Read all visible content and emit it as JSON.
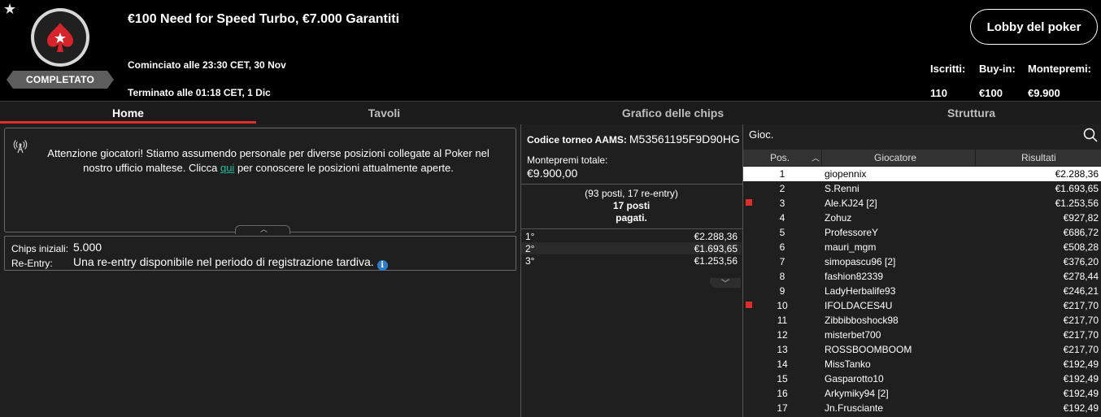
{
  "header": {
    "title": "€100 Need for Speed Turbo, €7.000 Garantiti",
    "status": "COMPLETATO",
    "started": "Cominciato alle 23:30 CET, 30 Nov",
    "ended": "Terminato alle 01:18 CET, 1 Dic",
    "lobby_button": "Lobby del poker",
    "stats": [
      {
        "label": "Iscritti:",
        "value": "110"
      },
      {
        "label": "Buy-in:",
        "value": "€100"
      },
      {
        "label": "Montepremi:",
        "value": "€9.900"
      }
    ]
  },
  "tabs": [
    "Home",
    "Tavoli",
    "Grafico delle chips",
    "Struttura"
  ],
  "active_tab": "Home",
  "notice": {
    "line1": "Attenzione giocatori! Stiamo assumendo personale per diverse posizioni collegate al Poker nel",
    "line2_before": "nostro ufficio maltese. Clicca ",
    "link": "qui",
    "line2_after": " per conoscere le posizioni attualmente aperte."
  },
  "info": {
    "chips_label": "Chips iniziali:",
    "chips_value": "5.000",
    "reentry_label": "Re-Entry:",
    "reentry_value": "Una re-entry disponibile nel periodo di registrazione tardiva."
  },
  "tournament": {
    "aams_label": "Codice torneo AAMS:",
    "aams_code": "M53561195F9D90HG",
    "prize_label": "Montepremi totale:",
    "prize_value": "€9.900,00",
    "entries_line": "(93 posti, 17 re-entry)",
    "paid_line1": "17 posti",
    "paid_line2": "pagati.",
    "payouts": [
      {
        "pos": "1°",
        "amount": "€2.288,36"
      },
      {
        "pos": "2°",
        "amount": "€1.693,65"
      },
      {
        "pos": "3°",
        "amount": "€1.253,56"
      }
    ]
  },
  "results": {
    "search_label": "Gioc.",
    "columns": [
      "Pos.",
      "Giocatore",
      "Risultati"
    ],
    "rows": [
      {
        "pos": "1",
        "name": "giopennix",
        "result": "€2.288,36",
        "flag": false
      },
      {
        "pos": "2",
        "name": "S.Renni",
        "result": "€1.693,65",
        "flag": false
      },
      {
        "pos": "3",
        "name": "Ale.KJ24 [2]",
        "result": "€1.253,56",
        "flag": true
      },
      {
        "pos": "4",
        "name": "Zohuz",
        "result": "€927,82",
        "flag": false
      },
      {
        "pos": "5",
        "name": "ProfessoreY",
        "result": "€686,72",
        "flag": false
      },
      {
        "pos": "6",
        "name": "mauri_mgm",
        "result": "€508,28",
        "flag": false
      },
      {
        "pos": "7",
        "name": "simopascu96 [2]",
        "result": "€376,20",
        "flag": false
      },
      {
        "pos": "8",
        "name": "fashion82339",
        "result": "€278,44",
        "flag": false
      },
      {
        "pos": "9",
        "name": "LadyHerbalife93",
        "result": "€246,21",
        "flag": false
      },
      {
        "pos": "10",
        "name": "IFOLDACES4U",
        "result": "€217,70",
        "flag": true
      },
      {
        "pos": "11",
        "name": "Zibbibboshock98",
        "result": "€217,70",
        "flag": false
      },
      {
        "pos": "12",
        "name": "misterbet700",
        "result": "€217,70",
        "flag": false
      },
      {
        "pos": "13",
        "name": "ROSSBOOMBOOM",
        "result": "€217,70",
        "flag": false
      },
      {
        "pos": "14",
        "name": "MissTanko",
        "result": "€192,49",
        "flag": false
      },
      {
        "pos": "15",
        "name": "Gasparotto10",
        "result": "€192,49",
        "flag": false
      },
      {
        "pos": "16",
        "name": "Arkymiky94 [2]",
        "result": "€192,49",
        "flag": false
      },
      {
        "pos": "17",
        "name": "Jn.Frusciante",
        "result": "€192,49",
        "flag": false
      }
    ]
  },
  "colors": {
    "accent": "#e22b2b",
    "link": "#1bbf9b",
    "panel": "#1f1f1f"
  }
}
